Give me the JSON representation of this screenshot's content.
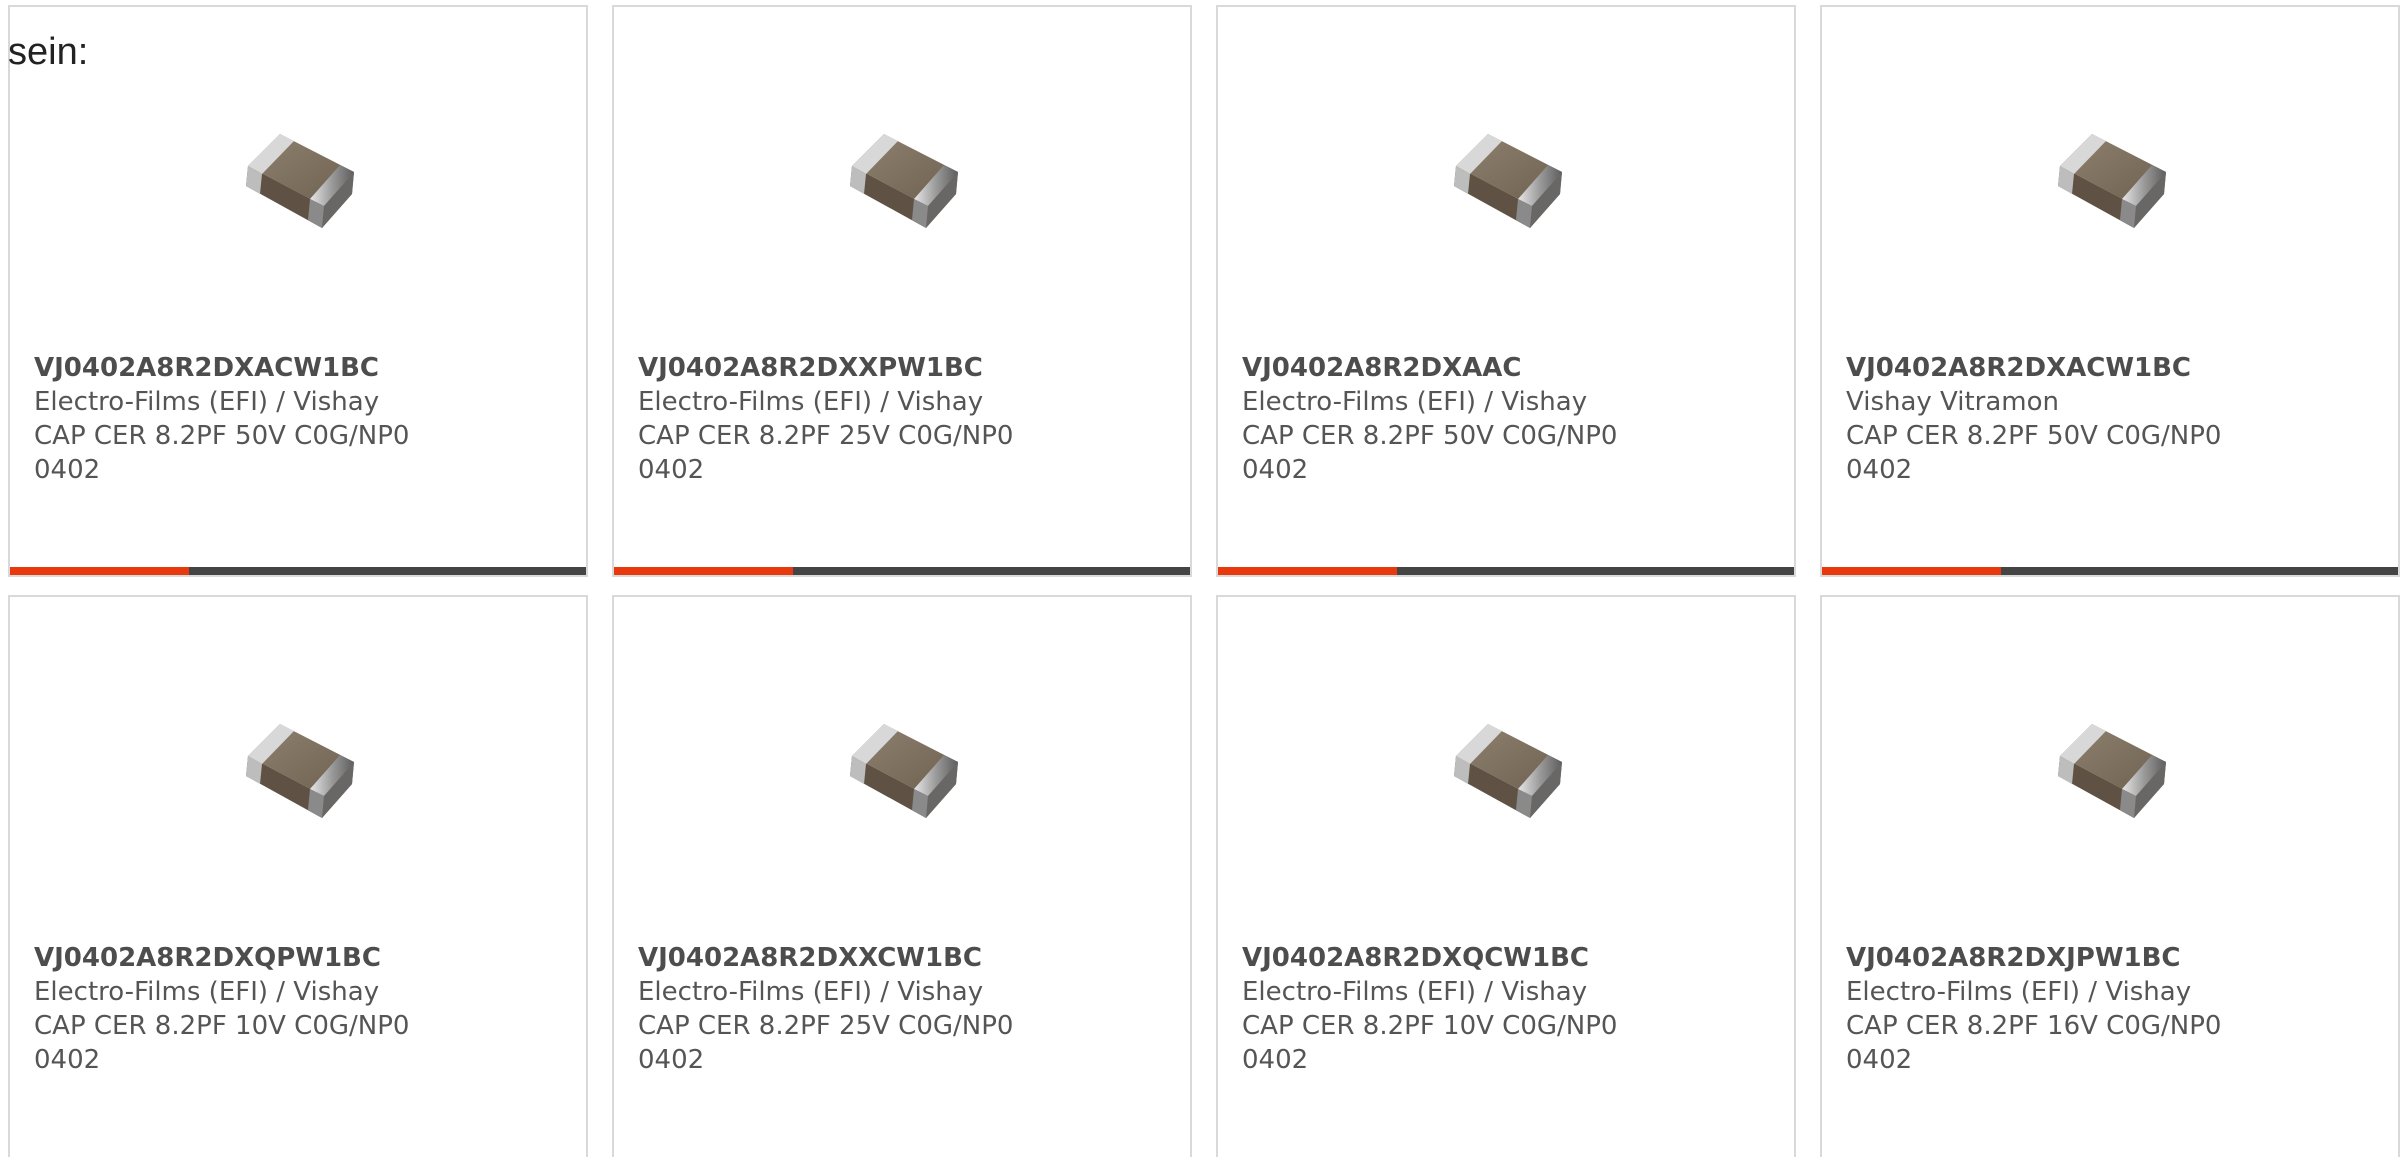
{
  "heading": "sein:",
  "colors": {
    "accent": "#e8380d",
    "bar_track": "#444444",
    "card_border": "#d9d9d9",
    "text": "#555555"
  },
  "bar_progress": 0.31,
  "image_icon": "ceramic-capacitor-chip",
  "cards": [
    {
      "part": "VJ0402A8R2DXACW1BC",
      "maker": "Electro-Films (EFI) / Vishay",
      "desc": "CAP CER 8.2PF 50V C0G/NP0",
      "pkg": "0402"
    },
    {
      "part": "VJ0402A8R2DXXPW1BC",
      "maker": "Electro-Films (EFI) / Vishay",
      "desc": "CAP CER 8.2PF 25V C0G/NP0",
      "pkg": "0402"
    },
    {
      "part": "VJ0402A8R2DXAAC",
      "maker": "Electro-Films (EFI) / Vishay",
      "desc": "CAP CER 8.2PF 50V C0G/NP0",
      "pkg": "0402"
    },
    {
      "part": "VJ0402A8R2DXACW1BC",
      "maker": "Vishay Vitramon",
      "desc": "CAP CER 8.2PF 50V C0G/NP0",
      "pkg": "0402"
    },
    {
      "part": "VJ0402A8R2DXQPW1BC",
      "maker": "Electro-Films (EFI) / Vishay",
      "desc": "CAP CER 8.2PF 10V C0G/NP0",
      "pkg": "0402"
    },
    {
      "part": "VJ0402A8R2DXXCW1BC",
      "maker": "Electro-Films (EFI) / Vishay",
      "desc": "CAP CER 8.2PF 25V C0G/NP0",
      "pkg": "0402"
    },
    {
      "part": "VJ0402A8R2DXQCW1BC",
      "maker": "Electro-Films (EFI) / Vishay",
      "desc": "CAP CER 8.2PF 10V C0G/NP0",
      "pkg": "0402"
    },
    {
      "part": "VJ0402A8R2DXJPW1BC",
      "maker": "Electro-Films (EFI) / Vishay",
      "desc": "CAP CER 8.2PF 16V C0G/NP0",
      "pkg": "0402"
    }
  ]
}
